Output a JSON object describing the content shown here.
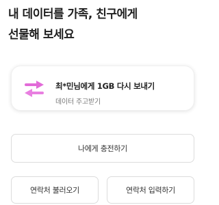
{
  "headline": {
    "line1": "내 데이터를 가족, 친구에게",
    "line2": "선물해 보세요"
  },
  "gift_card": {
    "title": "최*민님에게 1GB 다시 보내기",
    "subtitle": "데이터 주고받기",
    "icon": "exchange-arrows-icon",
    "arrow_color": "#e26bd8"
  },
  "buttons": {
    "charge_self": "나에게 충전하기",
    "load_contacts": "연락처 불러오기",
    "enter_contact": "연락처 입력하기"
  }
}
